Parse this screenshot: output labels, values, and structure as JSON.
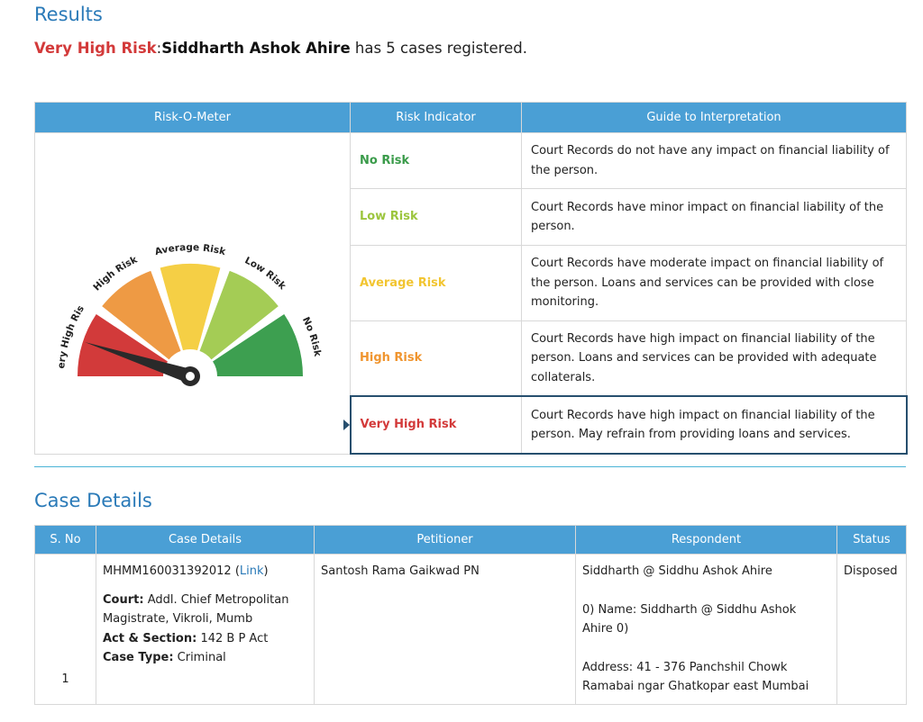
{
  "results_title": "Results",
  "summary": {
    "risk_label": "Very High Risk",
    "separator": ":",
    "person_name": "Siddharth Ashok Ahire",
    "suffix": " has 5 cases registered."
  },
  "risk_table": {
    "headers": [
      "Risk-O-Meter",
      "Risk Indicator",
      "Guide to Interpretation"
    ],
    "rows": [
      {
        "indicator": "No Risk",
        "color": "#3a9b4a",
        "guide": "Court Records do not have any impact on financial liability of the person."
      },
      {
        "indicator": "Low Risk",
        "color": "#9cc53d",
        "guide": "Court Records have minor impact on financial liability of the person."
      },
      {
        "indicator": "Average Risk",
        "color": "#f2c531",
        "guide": "Court Records have moderate impact on financial liability of the person. Loans and services can be provided with close monitoring."
      },
      {
        "indicator": "High Risk",
        "color": "#f0952f",
        "guide": "Court Records have high impact on financial liability of the person. Loans and services can be provided with adequate collaterals."
      },
      {
        "indicator": "Very High Risk",
        "color": "#d33a3a",
        "guide": "Court Records have high impact on financial liability of the person. May refrain from providing loans and services."
      }
    ],
    "selected": "Very High Risk"
  },
  "meter": {
    "segments": [
      {
        "label": "Very High Risk",
        "color": "#d23a3a"
      },
      {
        "label": "High Risk",
        "color": "#ee9a44"
      },
      {
        "label": "Average Risk",
        "color": "#f5cf45"
      },
      {
        "label": "Low Risk",
        "color": "#a4cc55"
      },
      {
        "label": "No Risk",
        "color": "#3d9f50"
      }
    ]
  },
  "case_section_title": "Case Details",
  "case_table": {
    "headers": [
      "S. No",
      "Case Details",
      "Petitioner",
      "Respondent",
      "Status"
    ],
    "rows": [
      {
        "sno": "1",
        "case_no": "MHMM160031392012",
        "link_open": " (",
        "link_text": "Link",
        "link_close": ")",
        "court_label": "Court:",
        "court_value": " Addl. Chief Metropolitan Magistrate, Vikroli, Mumb",
        "act_label": "Act & Section:",
        "act_value": " 142 B P Act",
        "type_label": "Case Type:",
        "type_value": " Criminal",
        "petitioner": "Santosh Rama Gaikwad PN",
        "respondent": "Siddharth @ Siddhu Ashok Ahire",
        "respondent_detail": "0) Name: Siddharth @ Siddhu Ashok Ahire 0)",
        "respondent_address": "Address: 41 - 376 Panchshil Chowk Ramabai ngar Ghatkopar east Mumbai",
        "status": "Disposed"
      }
    ]
  }
}
